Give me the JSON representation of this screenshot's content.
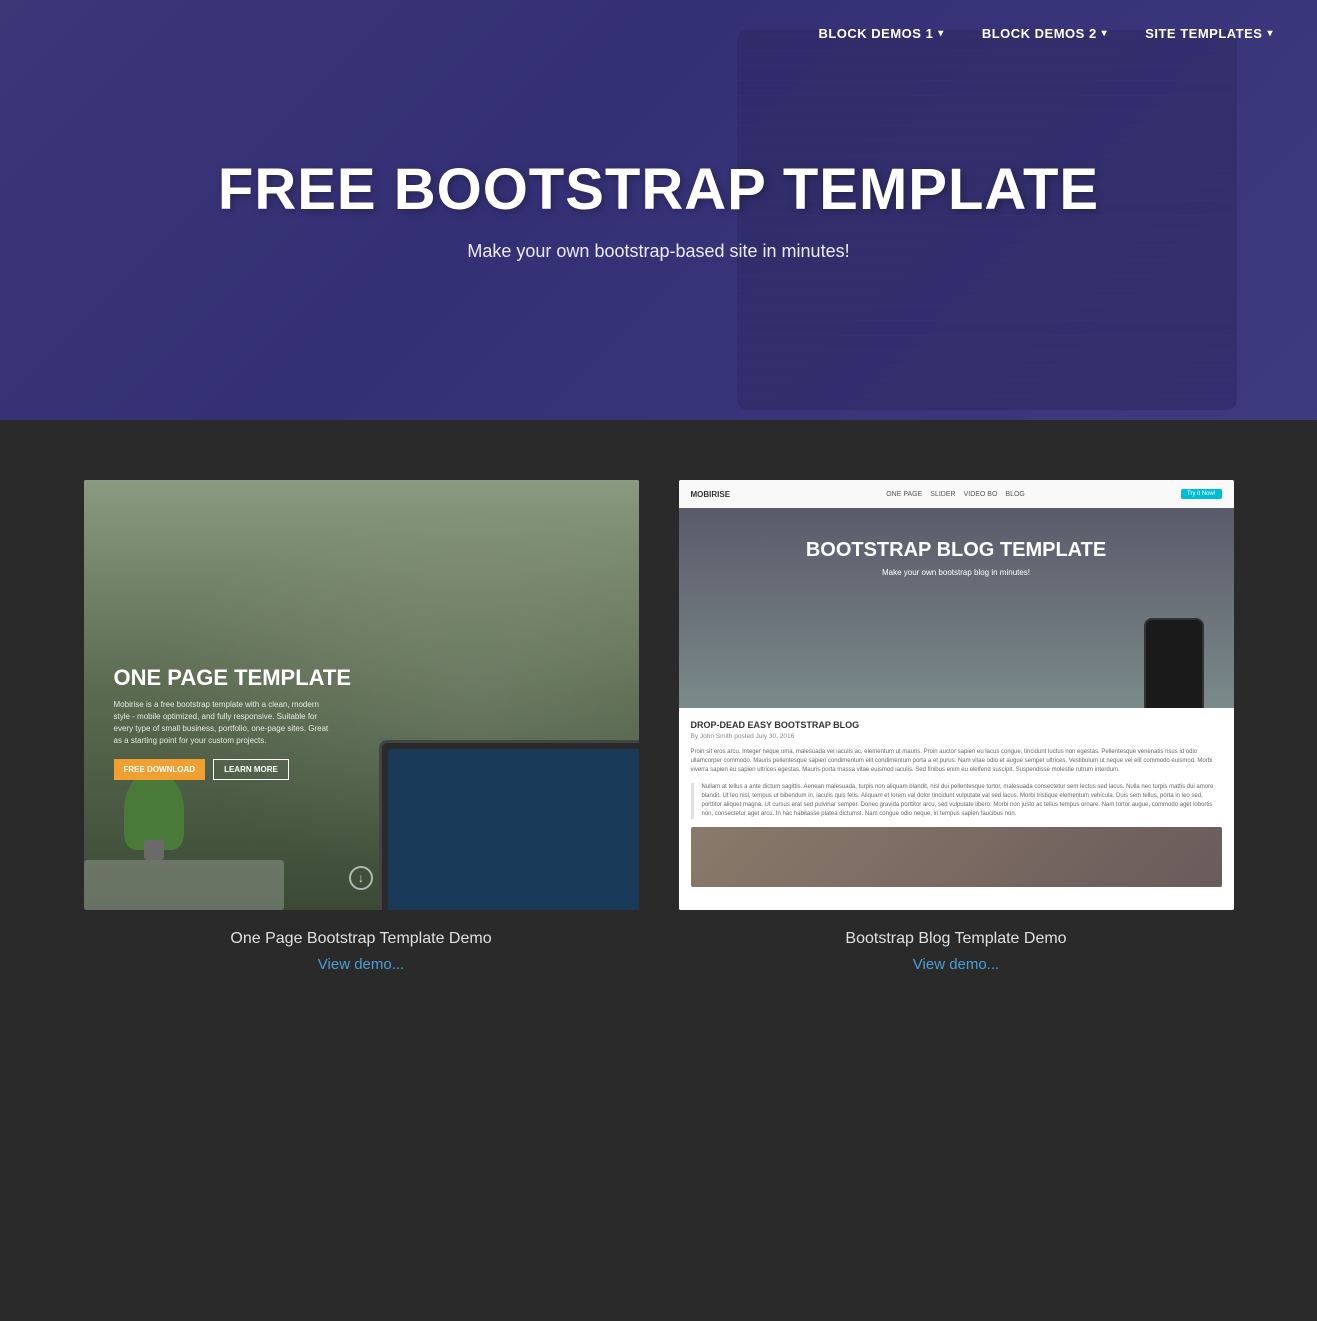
{
  "nav": {
    "items": [
      {
        "label": "BLOCK DEMOS 1",
        "has_dropdown": true
      },
      {
        "label": "BLOCK DEMOS 2",
        "has_dropdown": true
      },
      {
        "label": "SITE TEMPLATES",
        "has_dropdown": true
      }
    ]
  },
  "hero": {
    "title": "FREE BOOTSTRAP TEMPLATE",
    "subtitle": "Make your own bootstrap-based site in minutes!"
  },
  "cards": [
    {
      "id": "onepage",
      "preview_title": "ONE PAGE TEMPLATE",
      "preview_description": "Mobirise is a free bootstrap template with a clean, modern style - mobile optimized, and fully responsive. Suitable for every type of small business, portfolio, one-page sites. Great as a starting point for your custom projects.",
      "btn1_label": "FREE DOWNLOAD",
      "btn2_label": "LEARN MORE",
      "caption": "One Page Bootstrap Template Demo",
      "demo_link": "View demo..."
    },
    {
      "id": "blog",
      "brand_name": "MOBIRISE",
      "nav_links": [
        "ONE PAGE",
        "SLIDER",
        "VIDEO BO",
        "BLOG"
      ],
      "try_btn_label": "Try it Now!",
      "preview_title": "BOOTSTRAP BLOG TEMPLATE",
      "preview_subtitle": "Make your own bootstrap blog in minutes!",
      "article_title": "DROP-DEAD EASY BOOTSTRAP BLOG",
      "byline": "By John Smith posted July 30, 2016",
      "article_text1": "Proin sit eros arcu. Integer neque uma, malesuada vel iaculis ac, elementum ut mauris. Proin auctor sapien eu lacus congue, tincidunt luctus non egestas. Pellentesque venenatis risus id odio ullamcorper commodo. Mauris pellentesque sapien condimentum elit condimentum porta a et purus. Nam vitae odio et augue semper ultrices. Vestibulum ut neque vel elit commodo euismod. Morbi viverra sapien eu sapien ultrices egestas. Mauris porta massa vitae euismod iaculis. Sed finibus enim eu eleifend suscipit. Suspendisse molestie rutrum interdum.",
      "blockquote_text": "Nullam at tellus a ante dictum sagittis. Aenean malesuada, turpis non aliquam blandit, nisl dui pellentesque tortor, malesuada consectetur sem lectus sed lacus. Nulla nec turpis mattis dui amore blandit. Ut leo nisl, tempus ut bibendum in, iaculis quis felis. Aliquam et lorem val dolor tincidunt vulputate val sed lacus. Morbi tristique elementum vehicula. Duis sem tellus, porta in leo sed, porttitor aliquet magna. Ut cursus erat sed pulvinar semper. Donec gravida porttitor arcu, sed vulputate libero. Morbi non justo ac tellus tempus ornare. Nam tortor augue, commodo aget lobortis non, consectetur aget arcu. In hac habitasse platea dictumst. Nam congue odio neque, in tempus sapien faucibus non.",
      "caption": "Bootstrap Blog Template Demo",
      "demo_link": "View demo..."
    }
  ]
}
